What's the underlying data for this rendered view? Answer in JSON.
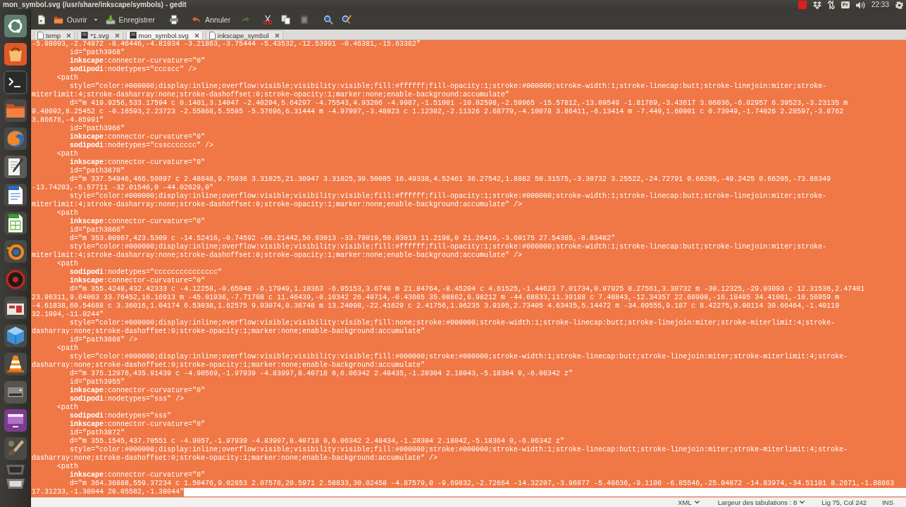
{
  "panel": {
    "title": "mon_symbol.svg (/usr/share/inkscape/symbols) - gedit",
    "keyboard_layout": "Fr",
    "clock": "22:33"
  },
  "toolbar": [
    {
      "kind": "new",
      "disabled": false
    },
    {
      "kind": "open",
      "label": "Ouvrir",
      "disabled": false
    },
    {
      "kind": "recent",
      "disabled": false
    },
    {
      "kind": "save",
      "label": "Enregistrer",
      "disabled": false
    },
    {
      "kind": "print",
      "disabled": false
    },
    {
      "kind": "undo",
      "label": "Annuler",
      "disabled": false
    },
    {
      "kind": "redo",
      "disabled": true
    },
    {
      "kind": "cut",
      "disabled": false
    },
    {
      "kind": "copy",
      "disabled": false
    },
    {
      "kind": "paste",
      "disabled": true
    },
    {
      "kind": "find",
      "disabled": false
    },
    {
      "kind": "replace",
      "disabled": false
    }
  ],
  "tabs": [
    {
      "label": "temp",
      "kind": "text",
      "selected": false
    },
    {
      "label": "*1.svg",
      "kind": "image",
      "selected": false
    },
    {
      "label": "mon_symbol.svg",
      "kind": "image",
      "selected": true
    },
    {
      "label": "inkscape_symbol",
      "kind": "text",
      "selected": false
    }
  ],
  "editor": {
    "text_selected": true,
    "lines": [
      "-5.98093,-2.74972 -8.46446,-4.81034 -3.21863,-3.75444 -5.43532,-12.53991 -0.46381,-15.63362\"",
      "         id=\"path3968\"",
      "         **inkscape**:connector-curvature=\"0\"",
      "         **sodipodi**:nodetypes=\"cccscc\" />",
      "      <path",
      "         style=\"color:#000000;display:inline;overflow:visible;visibility:visible;fill:#ffffff;fill-opacity:1;stroke:#000000;stroke-width:1;stroke-linecap:butt;stroke-linejoin:miter;stroke-",
      "miterlimit:4;stroke-dasharray:none;stroke-dashoffset:0;stroke-opacity:1;marker:none;enable-background:accumulate\"",
      "         d=\"m 419.9256,533.17594 c 0.1401,3.14047 -2.40204,5.64297 -4.75543,4.93206 -4.9987,-1.51001 -10.02598,-2.59965 -15.57812,-13.09549 -1.81769,-3.43617 3.06036,-6.02957 6.39523,-3.23135 m",
      "9.48092,8.25452 c -0.16593,2.23723 -2.55868,5.5595 -5.37696,6.31444 m -4.97997,-3.48923 c 1.12302,-2.11326 2.68779,-4.10078 3.86411,-6.13414 m -7.449,1.60901 c 0.73949,-1.74026 2.28597,-3.8762",
      "3.86676,-4.85991\"",
      "         id=\"path3966\"",
      "         **inkscape**:connector-curvature=\"0\"",
      "         **sodipodi**:nodetypes=\"cssccccccc\" />",
      "      <path",
      "         **inkscape**:connector-curvature=\"0\"",
      "         id=\"path3870\"",
      "         d=\"m 337.54946,466.59897 c 2.48848,9.75936 3.31025,21.30947 3.31025,30.50085 16.49338,4.52461 36.27542,1.8882 50.31575,-3.30732 3.25522,-24.72791 0.66205,-49.2425 0.66205,-73.86349",
      "-13.74203,-5.57711 -32.01546,0 -44.02629,0\"",
      "         style=\"color:#000000;display:inline;overflow:visible;visibility:visible;fill:#ffffff;fill-opacity:1;stroke:#000000;stroke-width:1;stroke-linecap:butt;stroke-linejoin:miter;stroke-",
      "miterlimit:4;stroke-dasharray:none;stroke-dashoffset:0;stroke-opacity:1;marker:none;enable-background:accumulate\" />",
      "      <path",
      "         **inkscape**:connector-curvature=\"0\"",
      "         id=\"path3866\"",
      "         d=\"m 353.00867,423.5309 c -14.52416,-0.74592 -66.21442,50.93013 -33.78019,50.93013 11.2198,0 21.26416,-3.60175 27.54385,-8.83482\"",
      "         style=\"color:#000000;display:inline;overflow:visible;visibility:visible;fill:#ffffff;fill-opacity:1;stroke:#000000;stroke-width:1;stroke-linecap:butt;stroke-linejoin:miter;stroke-",
      "miterlimit:4;stroke-dasharray:none;stroke-dashoffset:0;stroke-opacity:1;marker:none;enable-background:accumulate\" />",
      "      <path",
      "         **sodipodi**:nodetypes=\"ccccccccccccccc\"",
      "         **inkscape**:connector-curvature=\"0\"",
      "         d=\"m 355.4248,432.42333 c -4.12258,-0.65048 -6.17949,1.10363 -6.95153,3.6748 m 21.84764,-8.45204 c 4.61525,-1.44623 7.01734,0.97925 8.27561,3.30732 m -30.12325,-29.03093 c 12.31536,2.47401",
      "23.96311,9.64063 33.76452,16.16913 m -45.01936,-7.71708 c 11.46439,-0.10342 26.49714,-0.43605 35.08862,6.98212 m -44.68833,11.39188 c 7.48843,-12.34357 22.60908,-16.18495 34.41061,-10.56959 m",
      "-4.61838,60.54688 c 3.36016,1.04174 6.53038,1.62575 9.93074,0.36748 m 13.24098,-22.41629 c 2.41756,1.96235 3.9105,2.73405 4.63435,5.14472 m -34.09555,9.187 c 8.42275,9.00114 30.66464,-1.40119",
      "32.1094,-11.0244\"",
      "         style=\"color:#000000;display:inline;overflow:visible;visibility:visible;fill:none;stroke:#000000;stroke-width:1;stroke-linecap:butt;stroke-linejoin:miter;stroke-miterlimit:4;stroke-",
      "dasharray:none;stroke-dashoffset:0;stroke-opacity:1;marker:none;enable-background:accumulate\"",
      "         id=\"path3868\" />",
      "      <path",
      "         style=\"color:#000000;display:inline;overflow:visible;visibility:visible;fill:#000000;stroke:#000000;stroke-width:1;stroke-linecap:butt;stroke-linejoin:miter;stroke-miterlimit:4;stroke-",
      "dasharray:none;stroke-dashoffset:0;stroke-opacity:1;marker:none;enable-background:accumulate\"",
      "         d=\"m 375.12076,435.91439 c -4.90569,-1.97939 -4.83997,8.40718 0,6.06342 2.48435,-1.20304 2.18043,-5.18364 0,-6.06342 z\"",
      "         id=\"path3955\"",
      "         **inkscape**:connector-curvature=\"0\"",
      "         **sodipodi**:nodetypes=\"sss\" />",
      "      <path",
      "         **sodipodi**:nodetypes=\"sss\"",
      "         **inkscape**:connector-curvature=\"0\"",
      "         id=\"path3872\"",
      "         d=\"m 355.1545,437.70551 c -4.9057,-1.97939 -4.83997,8.40718 0,6.06342 2.48434,-1.20304 2.18042,-5.18364 0,-6.06342 z\"",
      "         style=\"color:#000000;display:inline;overflow:visible;visibility:visible;fill:#000000;stroke:#000000;stroke-width:1;stroke-linecap:butt;stroke-linejoin:miter;stroke-miterlimit:4;stroke-",
      "dasharray:none;stroke-dashoffset:0;stroke-opacity:1;marker:none;enable-background:accumulate\" />",
      "      <path",
      "         **inkscape**:connector-curvature=\"0\"",
      "         d=\"m 364.36888,559.37234 c 1.50476,9.02853 2.07578,20.5971 2.58833,30.02458 -4.87579,0 -9.69832,-2.72664 -14.32207,-3.96877 -5.46636,-9.1106 -6.85546,-25.04872 -14.83974,-34.51101 8.2671,-1.88863",
      "17.31233,-1.38044 26.05582,-1.38044\""
    ]
  },
  "status_bar": [
    {
      "kind": "language",
      "label": "XML"
    },
    {
      "kind": "tab-width",
      "label": "Largeur des tabulations : 8"
    },
    {
      "kind": "cursor-position",
      "label": "Lig 75, Col 242"
    },
    {
      "kind": "insert-mode",
      "label": "INS"
    }
  ]
}
